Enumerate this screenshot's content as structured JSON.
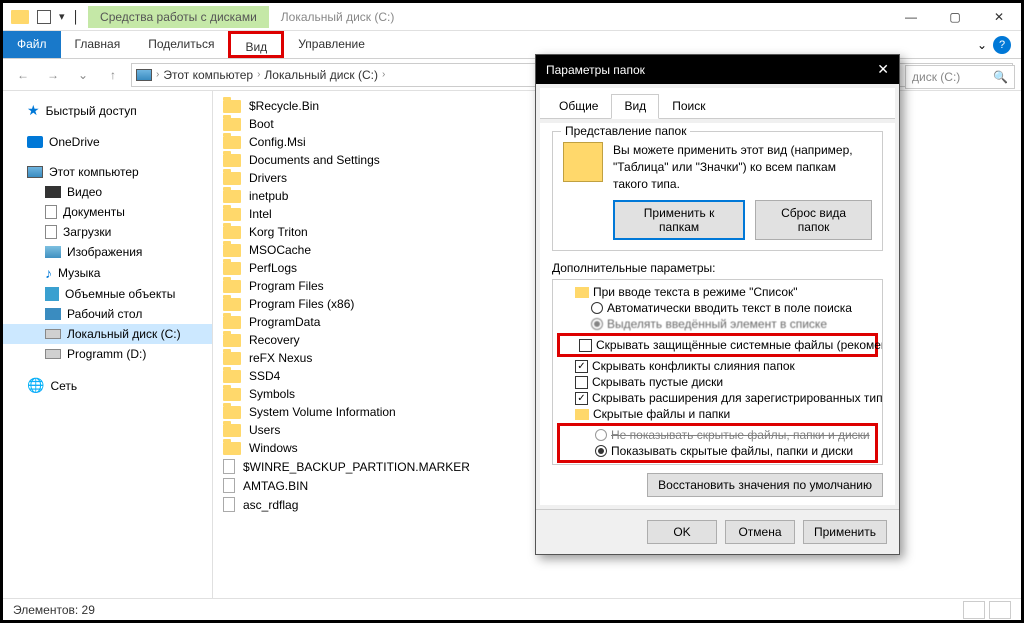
{
  "titlebar": {
    "drive_tools": "Средства работы с дисками",
    "title": "Локальный диск (C:)"
  },
  "ribbon": {
    "file": "Файл",
    "home": "Главная",
    "share": "Поделиться",
    "view": "Вид",
    "manage": "Управление"
  },
  "breadcrumb": {
    "pc": "Этот компьютер",
    "drive": "Локальный диск (C:)"
  },
  "search": {
    "placeholder_right": "диск (C:)"
  },
  "sidebar": {
    "quick_access": "Быстрый доступ",
    "onedrive": "OneDrive",
    "this_pc": "Этот компьютер",
    "videos": "Видео",
    "documents": "Документы",
    "downloads": "Загрузки",
    "pictures": "Изображения",
    "music": "Музыка",
    "objects3d": "Объемные объекты",
    "desktop": "Рабочий стол",
    "drive_c": "Локальный диск (C:)",
    "drive_d": "Programm (D:)",
    "network": "Сеть"
  },
  "files": [
    {
      "name": "$Recycle.Bin",
      "type": "folder"
    },
    {
      "name": "Boot",
      "type": "folder"
    },
    {
      "name": "Config.Msi",
      "type": "folder"
    },
    {
      "name": "Documents and Settings",
      "type": "folder"
    },
    {
      "name": "Drivers",
      "type": "folder"
    },
    {
      "name": "inetpub",
      "type": "folder"
    },
    {
      "name": "Intel",
      "type": "folder"
    },
    {
      "name": "Korg Triton",
      "type": "folder"
    },
    {
      "name": "MSOCache",
      "type": "folder"
    },
    {
      "name": "PerfLogs",
      "type": "folder"
    },
    {
      "name": "Program Files",
      "type": "folder"
    },
    {
      "name": "Program Files (x86)",
      "type": "folder"
    },
    {
      "name": "ProgramData",
      "type": "folder"
    },
    {
      "name": "Recovery",
      "type": "folder"
    },
    {
      "name": "reFX Nexus",
      "type": "folder"
    },
    {
      "name": "SSD4",
      "type": "folder"
    },
    {
      "name": "Symbols",
      "type": "folder"
    },
    {
      "name": "System Volume Information",
      "type": "folder"
    },
    {
      "name": "Users",
      "type": "folder"
    },
    {
      "name": "Windows",
      "type": "folder"
    },
    {
      "name": "$WINRE_BACKUP_PARTITION.MARKER",
      "type": "file"
    },
    {
      "name": "AMTAG.BIN",
      "type": "file"
    },
    {
      "name": "asc_rdflag",
      "type": "file"
    }
  ],
  "statusbar": {
    "items": "Элементов: 29"
  },
  "dialog": {
    "title": "Параметры папок",
    "tabs": {
      "general": "Общие",
      "view": "Вид",
      "search": "Поиск"
    },
    "folder_view": {
      "group": "Представление папок",
      "text": "Вы можете применить этот вид (например, \"Таблица\" или \"Значки\") ко всем папкам такого типа.",
      "apply_btn": "Применить к папкам",
      "reset_btn": "Сброс вида папок"
    },
    "advanced": {
      "label": "Дополнительные параметры:",
      "items": {
        "list_mode": "При вводе текста в режиме \"Список\"",
        "auto_type": "Автоматически вводить текст в поле поиска",
        "hide_protected": "Скрывать защищённые системные файлы (рекомен.",
        "hide_conflicts": "Скрывать конфликты слияния папок",
        "hide_empty": "Скрывать пустые диски",
        "hide_ext": "Скрывать расширения для зарегистрированных типо",
        "hidden_group": "Скрытые файлы и папки",
        "dont_show": "Не показывать скрытые файлы, папки и диски",
        "show_hidden": "Показывать скрытые файлы, папки и диски"
      },
      "restore": "Восстановить значения по умолчанию"
    },
    "footer": {
      "ok": "OK",
      "cancel": "Отмена",
      "apply": "Применить"
    }
  }
}
